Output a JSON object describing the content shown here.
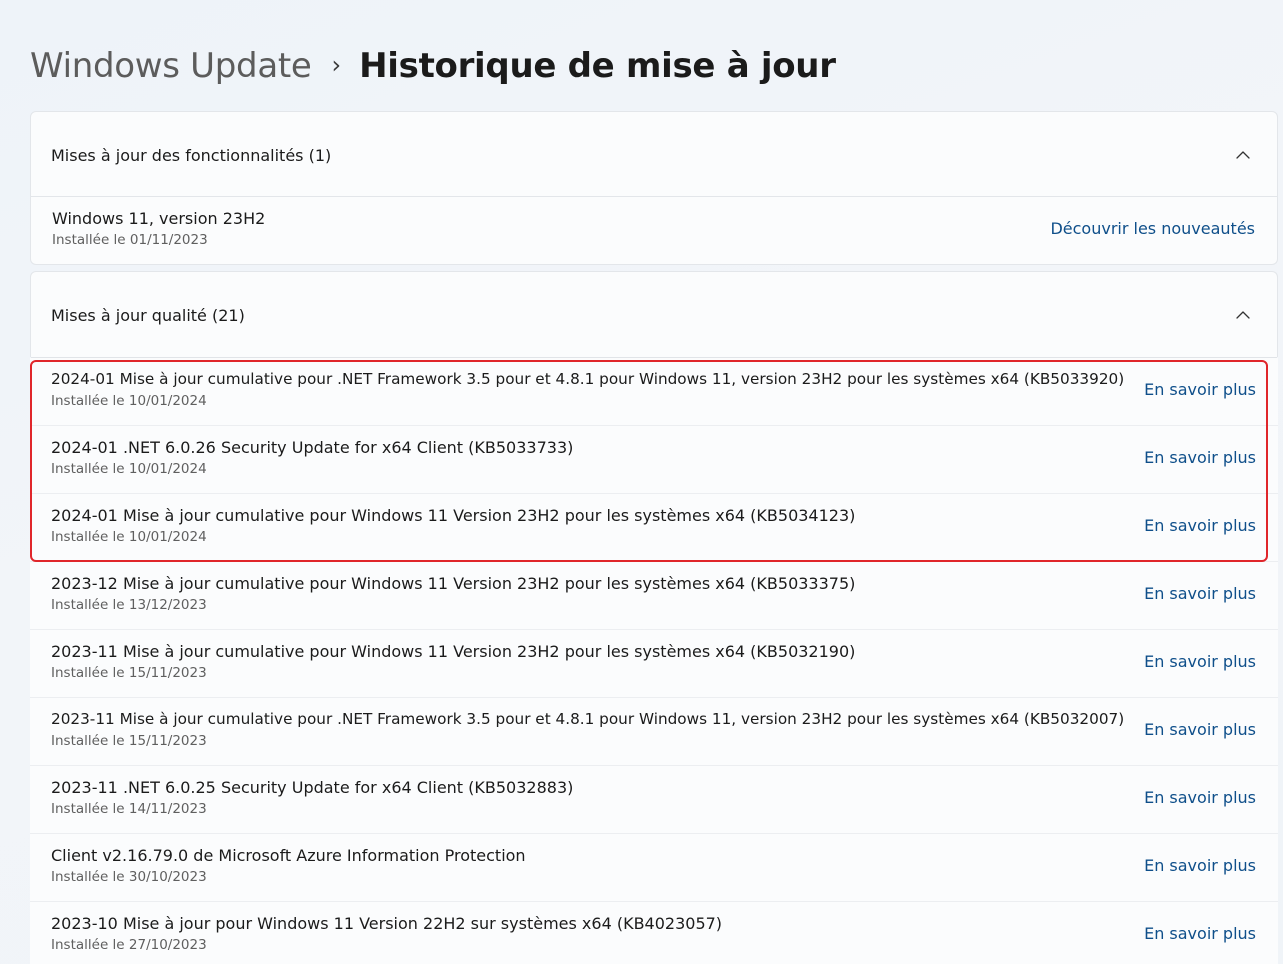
{
  "breadcrumb": {
    "parent": "Windows Update",
    "separator": "›",
    "current": "Historique de mise à jour"
  },
  "feature_updates": {
    "title": "Mises à jour des fonctionnalités (1)",
    "expanded": true,
    "items": [
      {
        "title": "Windows 11, version 23H2",
        "installed": "Installée le 01/11/2023",
        "link": "Découvrir les nouveautés"
      }
    ]
  },
  "quality_updates": {
    "title": "Mises à jour qualité (21)",
    "expanded": true,
    "items": [
      {
        "title": "2024-01 Mise à jour cumulative pour .NET Framework 3.5 pour et 4.8.1 pour Windows 11, version 23H2 pour les systèmes x64 (KB5033920)",
        "installed": "Installée le 10/01/2024",
        "link": "En savoir plus"
      },
      {
        "title": "2024-01 .NET 6.0.26 Security Update for x64 Client (KB5033733)",
        "installed": "Installée le 10/01/2024",
        "link": "En savoir plus"
      },
      {
        "title": "2024-01 Mise à jour cumulative pour Windows 11 Version 23H2 pour les systèmes x64 (KB5034123)",
        "installed": "Installée le 10/01/2024",
        "link": "En savoir plus"
      },
      {
        "title": "2023-12 Mise à jour cumulative pour Windows 11 Version 23H2 pour les systèmes x64 (KB5033375)",
        "installed": "Installée le 13/12/2023",
        "link": "En savoir plus"
      },
      {
        "title": "2023-11 Mise à jour cumulative pour Windows 11 Version 23H2 pour les systèmes x64 (KB5032190)",
        "installed": "Installée le 15/11/2023",
        "link": "En savoir plus"
      },
      {
        "title": "2023-11 Mise à jour cumulative pour .NET Framework 3.5 pour et 4.8.1 pour Windows 11, version 23H2 pour les systèmes x64 (KB5032007)",
        "installed": "Installée le 15/11/2023",
        "link": "En savoir plus"
      },
      {
        "title": "2023-11 .NET 6.0.25 Security Update for x64 Client (KB5032883)",
        "installed": "Installée le 14/11/2023",
        "link": "En savoir plus"
      },
      {
        "title": "Client v2.16.79.0 de Microsoft Azure Information Protection",
        "installed": "Installée le 30/10/2023",
        "link": "En savoir plus"
      },
      {
        "title": "2023-10 Mise à jour pour Windows 11 Version 22H2 sur systèmes x64 (KB4023057)",
        "installed": "Installée le 27/10/2023",
        "link": "En savoir plus"
      }
    ]
  },
  "colors": {
    "link": "#0f4f8a",
    "highlight_border": "#e0262b"
  }
}
